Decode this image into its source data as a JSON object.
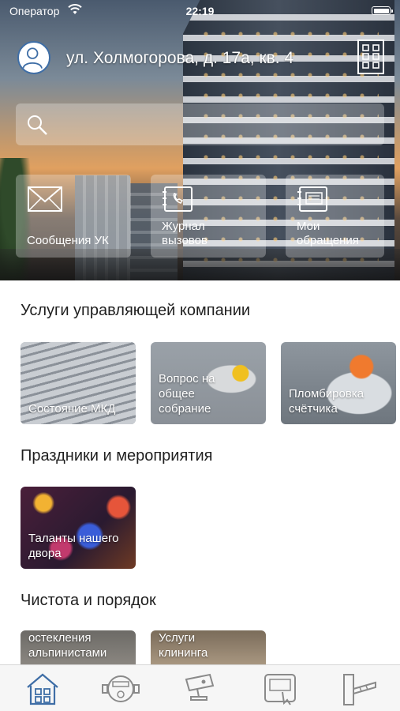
{
  "status_bar": {
    "carrier": "Оператор",
    "time": "22:19"
  },
  "header": {
    "address": "ул. Холмогорова, д. 17а, кв. 4"
  },
  "search": {
    "placeholder": ""
  },
  "quick_actions": [
    {
      "label": "Сообщения УК",
      "icon": "envelope-icon"
    },
    {
      "label": "Журнал вызовов",
      "icon": "intercom-phone-icon"
    },
    {
      "label": "Мои обращения",
      "icon": "device-icon"
    }
  ],
  "sections": [
    {
      "title": "Услуги управляющей компании",
      "cards": [
        {
          "label": "Состояние МКД"
        },
        {
          "label": "Вопрос на общее собрание"
        },
        {
          "label": "Пломбировка счётчика"
        }
      ]
    },
    {
      "title": "Праздники и мероприятия",
      "cards": [
        {
          "label": "Таланты нашего двора"
        }
      ]
    },
    {
      "title": "Чистота и порядок",
      "cards": [
        {
          "label": "остекления альпинистами"
        },
        {
          "label": "Услуги клининга"
        }
      ]
    }
  ],
  "tabbar": [
    {
      "icon": "home-icon",
      "active": true
    },
    {
      "icon": "meter-icon",
      "active": false
    },
    {
      "icon": "camera-icon",
      "active": false
    },
    {
      "icon": "intercom-icon",
      "active": false
    },
    {
      "icon": "barrier-icon",
      "active": false
    }
  ],
  "colors": {
    "accent": "#3f6ea6",
    "tab_inactive": "#8a8a8a"
  }
}
